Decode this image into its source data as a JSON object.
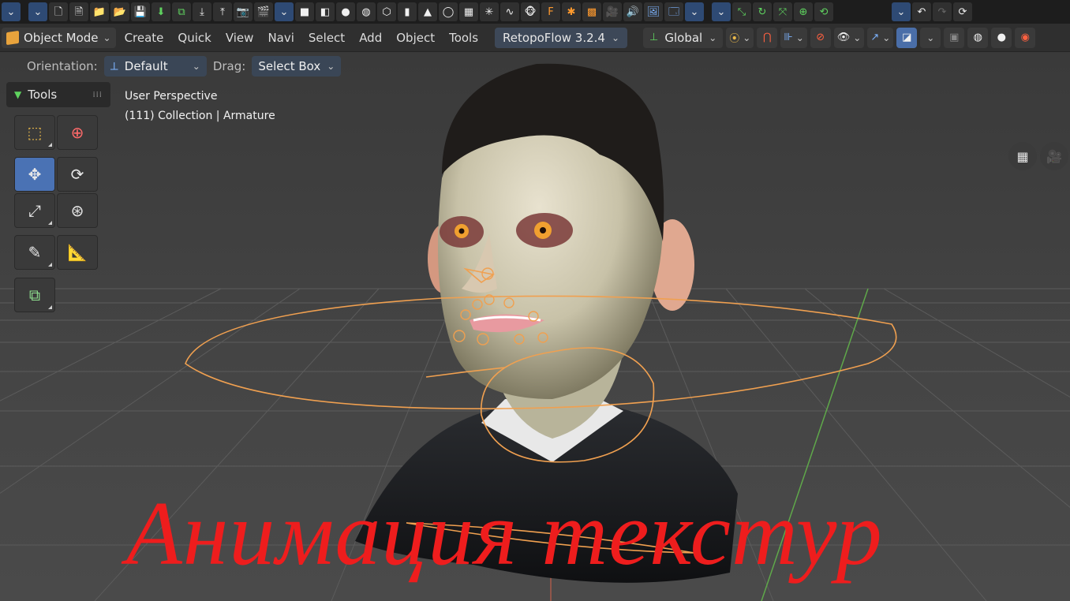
{
  "header": {
    "mode": "Object Mode",
    "menus": [
      "Create",
      "Quick",
      "View",
      "Navi",
      "Select",
      "Add",
      "Object",
      "Tools"
    ],
    "addon": "RetopoFlow 3.2.4",
    "transform_orientation": "Global"
  },
  "tool_settings": {
    "orientation_label": "Orientation:",
    "orientation_value": "Default",
    "drag_label": "Drag:",
    "drag_value": "Select Box"
  },
  "viewport": {
    "perspective": "User Perspective",
    "collection_info": "(111) Collection | Armature"
  },
  "tools_panel": {
    "title": "Tools"
  },
  "caption": "Анимация текстур",
  "colors": {
    "accent": "#4a72b4",
    "caption": "#ee1d1d",
    "armature": "#f0a050"
  }
}
